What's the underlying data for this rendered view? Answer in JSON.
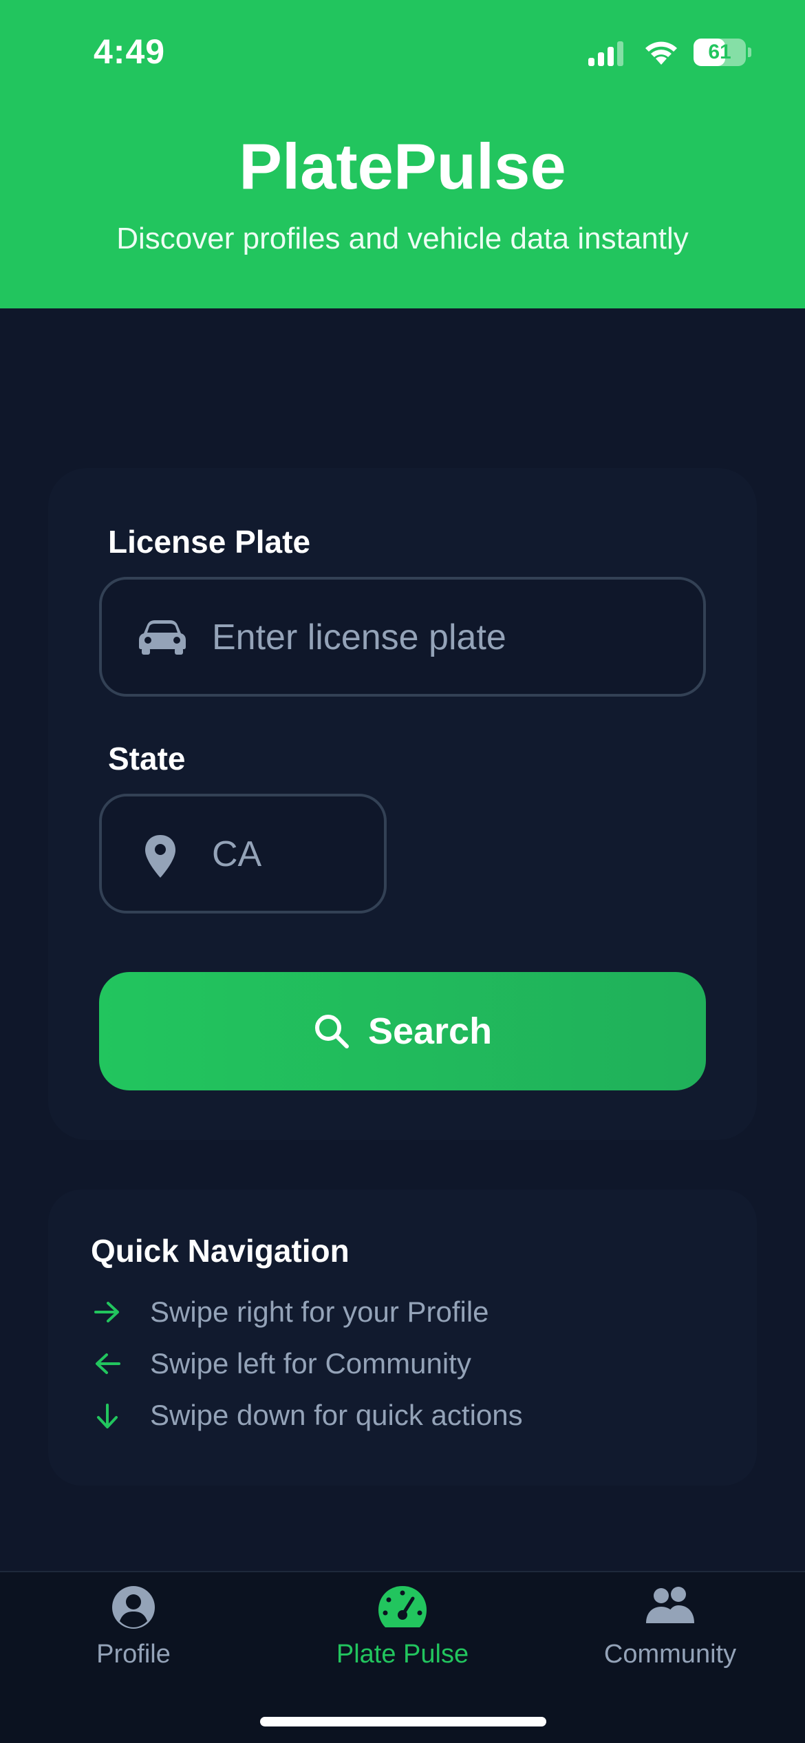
{
  "status_bar": {
    "time": "4:49",
    "battery": "61",
    "battery_level": 0.61
  },
  "header": {
    "title": "PlatePulse",
    "subtitle": "Discover profiles and vehicle data instantly"
  },
  "search_form": {
    "plate_label": "License Plate",
    "plate_placeholder": "Enter license plate",
    "plate_icon": "car-icon",
    "state_label": "State",
    "state_value": "CA",
    "state_icon": "map-pin-icon",
    "search_label": "Search",
    "search_icon": "magnifier-icon"
  },
  "quick_nav": {
    "title": "Quick Navigation",
    "items": [
      {
        "icon": "arrow-right-icon",
        "text": "Swipe right for your Profile"
      },
      {
        "icon": "arrow-left-icon",
        "text": "Swipe left for Community"
      },
      {
        "icon": "arrow-down-icon",
        "text": "Swipe down for quick actions"
      }
    ]
  },
  "tab_bar": {
    "tabs": [
      {
        "label": "Profile",
        "icon": "user-circle-icon",
        "active": false
      },
      {
        "label": "Plate Pulse",
        "icon": "speedometer-icon",
        "active": true
      },
      {
        "label": "Community",
        "icon": "users-icon",
        "active": false
      }
    ]
  },
  "colors": {
    "accent": "#22c55e",
    "background": "#0f172a",
    "card": "#111a2e",
    "muted_text": "#94a3b8"
  }
}
